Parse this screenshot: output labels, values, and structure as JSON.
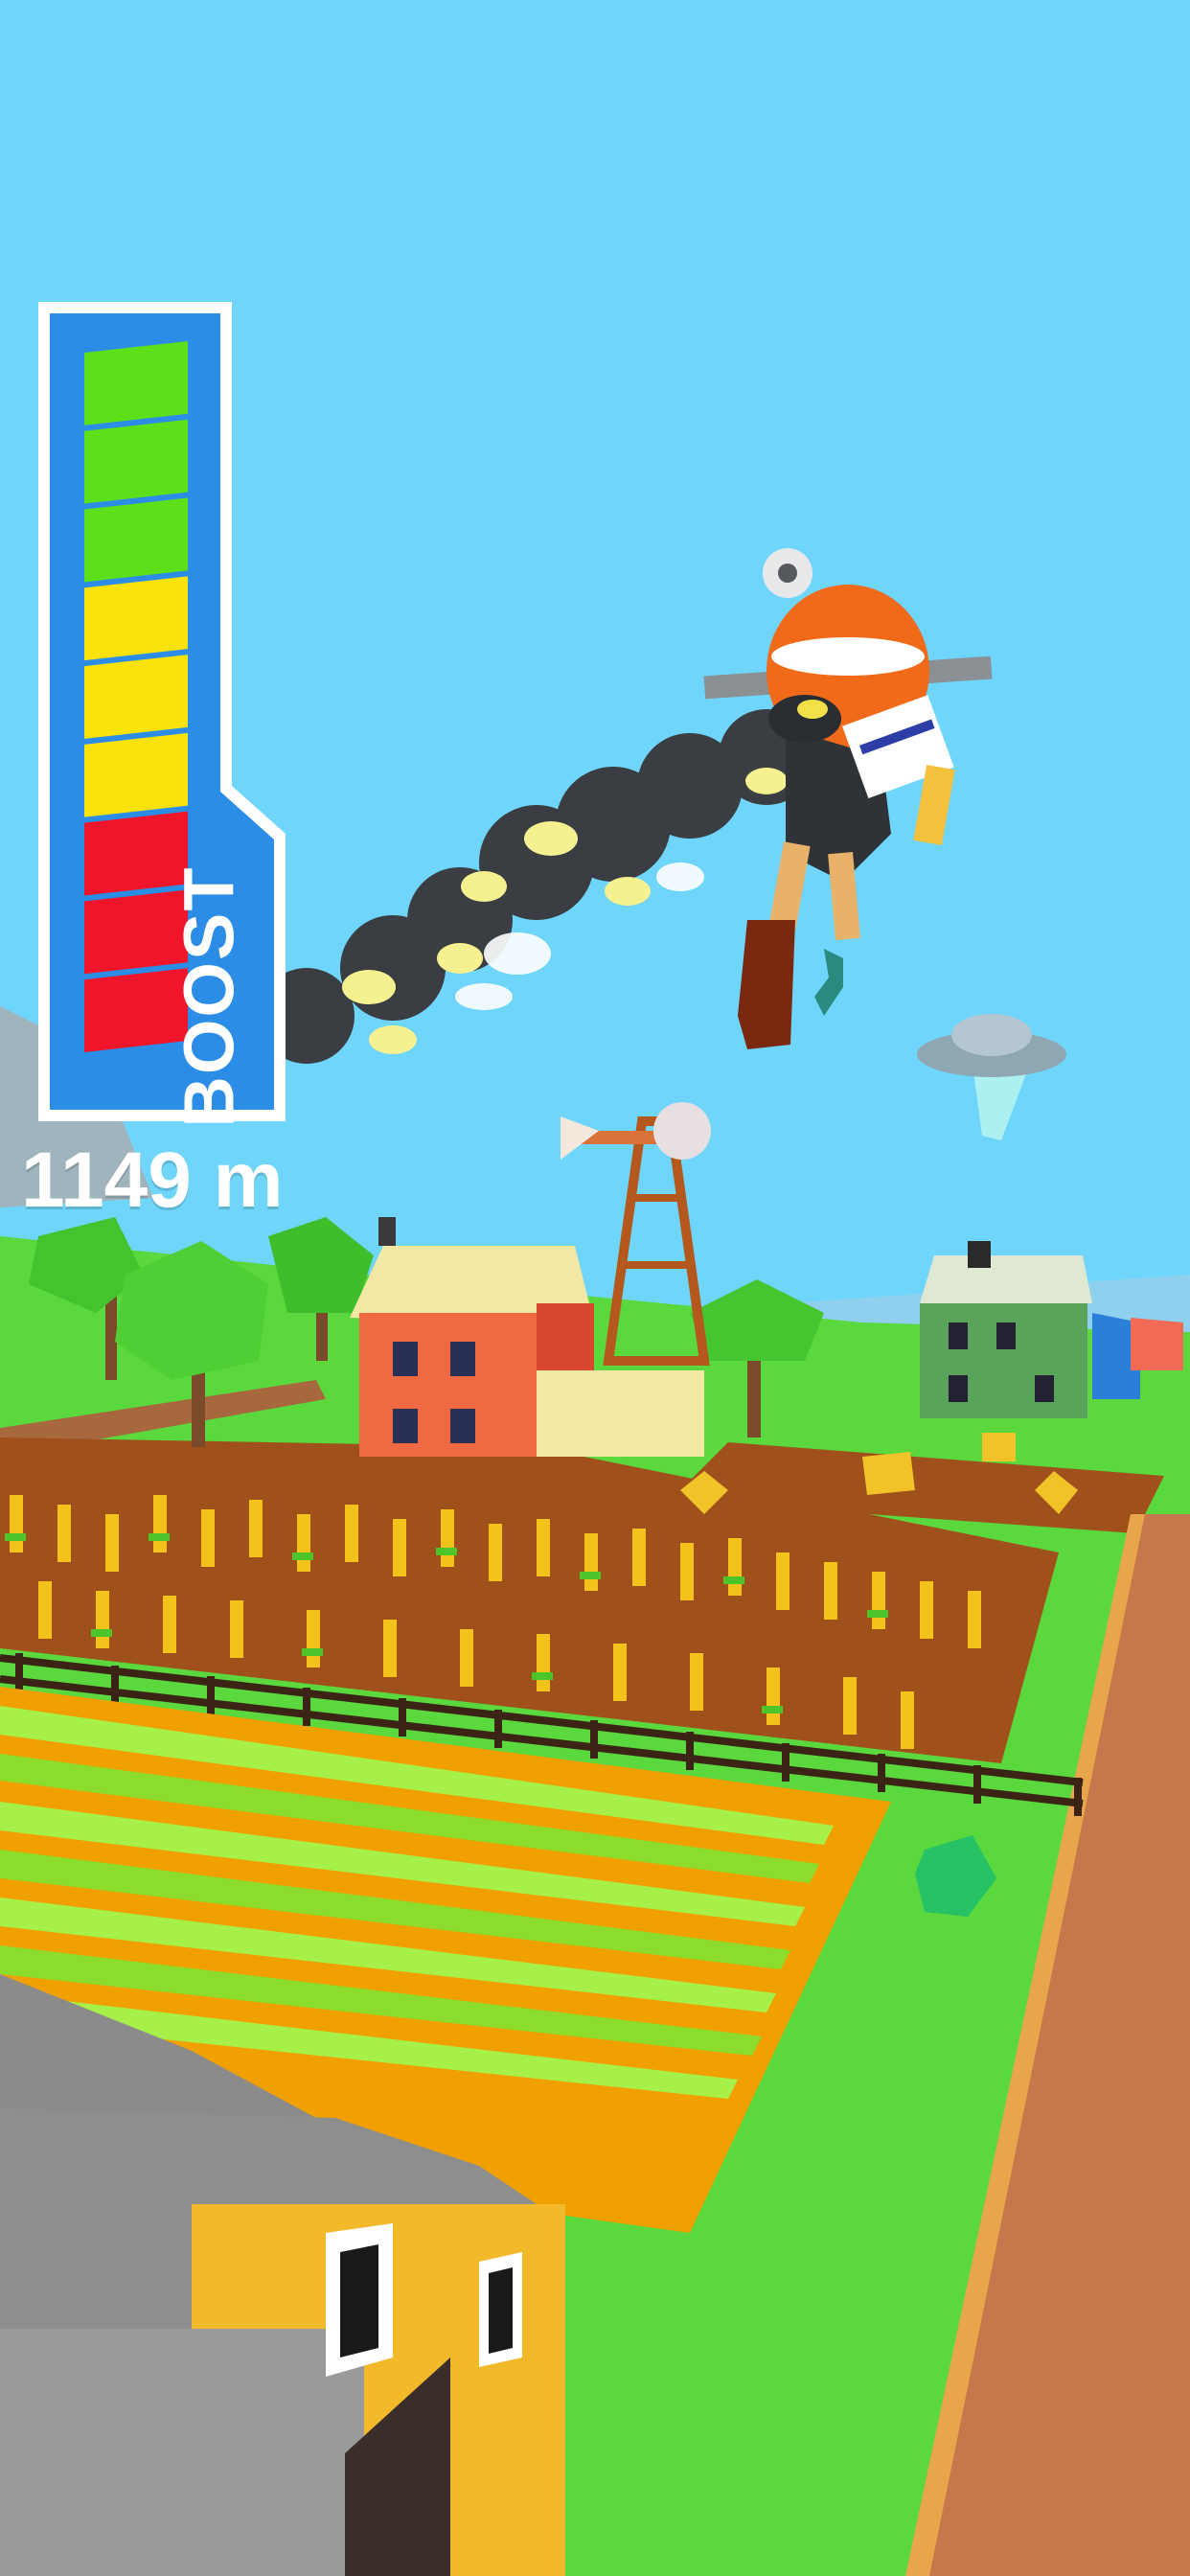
{
  "hud": {
    "boost_label": "BOOST",
    "boost_level": 1.0,
    "boost_segments": [
      "red",
      "red",
      "red",
      "yellow",
      "yellow",
      "yellow",
      "green",
      "green",
      "green"
    ],
    "distance": "1149 m"
  },
  "colors": {
    "sky": "#6fd5fb",
    "grass": "#5ad83e",
    "soil": "#a0501b",
    "road": "#c4784b",
    "meter_frame": "#2b8de6",
    "segment_red": "#f0152a",
    "segment_yellow": "#fbe20a",
    "segment_green": "#5ddf1a"
  },
  "scene": {
    "player": "jetpack-rider",
    "objects": [
      "ufo",
      "windmill",
      "farmhouse",
      "green-house",
      "barn",
      "corn-field",
      "hay-bales",
      "trees",
      "fence",
      "smoke-trail"
    ]
  }
}
